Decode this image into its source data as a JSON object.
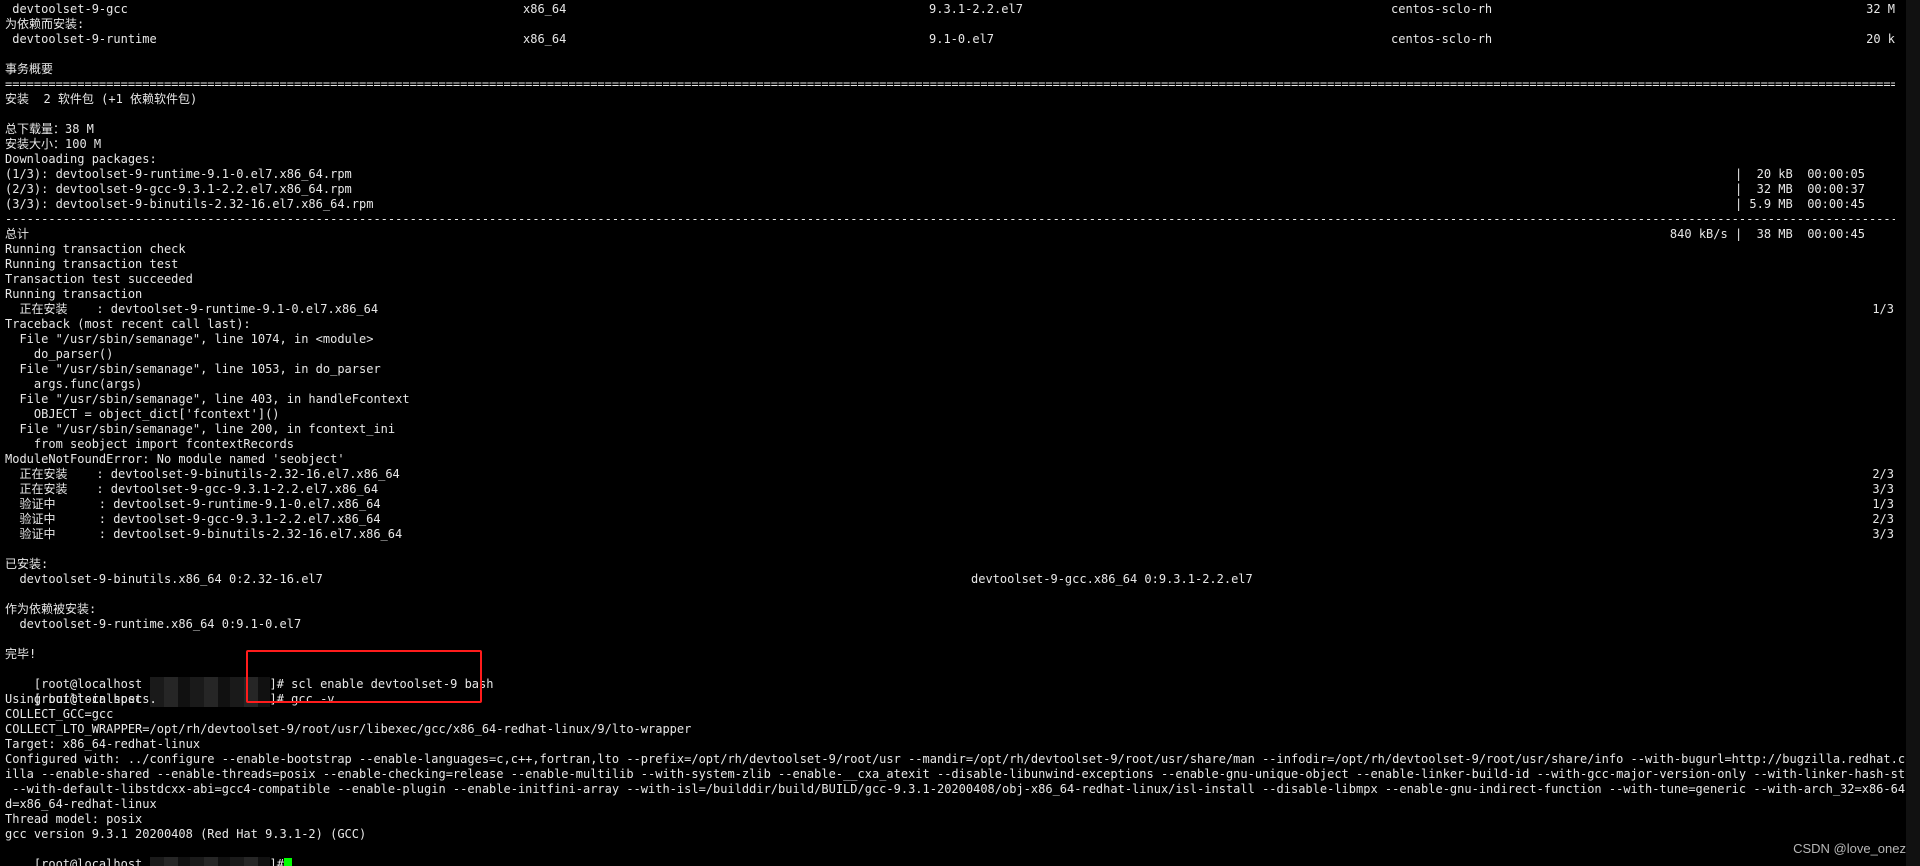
{
  "pkg_rows": [
    {
      "name": " devtoolset-9-gcc",
      "arch": "x86_64",
      "version": "9.3.1-2.2.el7",
      "repo": "centos-sclo-rh",
      "size": "32 M"
    },
    {
      "name": "为依赖而安装:",
      "arch": "",
      "version": "",
      "repo": "",
      "size": ""
    },
    {
      "name": " devtoolset-9-runtime",
      "arch": "x86_64",
      "version": "9.1-0.el7",
      "repo": "centos-sclo-rh",
      "size": "20 k"
    }
  ],
  "summary": {
    "title": "事务概要",
    "double_rule": "===========================================================================================================================================================================================================================================================================",
    "install_line": "安装  2 软件包 (+1 依赖软件包)",
    "total_download": "总下载量：38 M",
    "install_size": "安装大小：100 M",
    "downloading": "Downloading packages:"
  },
  "downloads": [
    {
      "file": "(1/3): devtoolset-9-runtime-9.1-0.el7.x86_64.rpm",
      "info": "|  20 kB  00:00:05"
    },
    {
      "file": "(2/3): devtoolset-9-gcc-9.3.1-2.2.el7.x86_64.rpm",
      "info": "|  32 MB  00:00:37"
    },
    {
      "file": "(3/3): devtoolset-9-binutils-2.32-16.el7.x86_64.rpm",
      "info": "| 5.9 MB  00:00:45"
    }
  ],
  "dash_rule": "---------------------------------------------------------------------------------------------------------------------------------------------------------------------------------------------------------------------------------------------------------------------------",
  "total": {
    "label": "总计",
    "info": "840 kB/s |  38 MB  00:00:45"
  },
  "transaction_lines": [
    "Running transaction check",
    "Running transaction test",
    "Transaction test succeeded",
    "Running transaction"
  ],
  "first_install": {
    "text": "  正在安装    : devtoolset-9-runtime-9.1-0.el7.x86_64",
    "count": "1/3"
  },
  "traceback_lines": [
    "Traceback (most recent call last):",
    "  File \"/usr/sbin/semanage\", line 1074, in <module>",
    "    do_parser()",
    "  File \"/usr/sbin/semanage\", line 1053, in do_parser",
    "    args.func(args)",
    "  File \"/usr/sbin/semanage\", line 403, in handleFcontext",
    "    OBJECT = object_dict['fcontext']()",
    "  File \"/usr/sbin/semanage\", line 200, in fcontext_ini",
    "    from seobject import fcontextRecords",
    "ModuleNotFoundError: No module named 'seobject'"
  ],
  "progress_lines": [
    {
      "text": "  正在安装    : devtoolset-9-binutils-2.32-16.el7.x86_64",
      "count": "2/3"
    },
    {
      "text": "  正在安装    : devtoolset-9-gcc-9.3.1-2.2.el7.x86_64",
      "count": "3/3"
    },
    {
      "text": "  验证中      : devtoolset-9-runtime-9.1-0.el7.x86_64",
      "count": "1/3"
    },
    {
      "text": "  验证中      : devtoolset-9-gcc-9.3.1-2.2.el7.x86_64",
      "count": "2/3"
    },
    {
      "text": "  验证中      : devtoolset-9-binutils-2.32-16.el7.x86_64",
      "count": "3/3"
    }
  ],
  "installed": {
    "title": "已安装:",
    "item1": "  devtoolset-9-binutils.x86_64 0:2.32-16.el7",
    "item2": "devtoolset-9-gcc.x86_64 0:9.3.1-2.2.el7"
  },
  "dep_installed": {
    "title": "作为依赖被安装:",
    "item": "  devtoolset-9-runtime.x86_64 0:9.1-0.el7"
  },
  "done": "完毕!",
  "prompt_user": "[root@localhost ",
  "prompt_end": "]#",
  "commands": [
    " scl enable devtoolset-9 bash",
    " gcc -v"
  ],
  "gcc_output": [
    "Using built-in specs.",
    "COLLECT_GCC=gcc",
    "COLLECT_LTO_WRAPPER=/opt/rh/devtoolset-9/root/usr/libexec/gcc/x86_64-redhat-linux/9/lto-wrapper",
    "Target: x86_64-redhat-linux",
    "Configured with: ../configure --enable-bootstrap --enable-languages=c,c++,fortran,lto --prefix=/opt/rh/devtoolset-9/root/usr --mandir=/opt/rh/devtoolset-9/root/usr/share/man --infodir=/opt/rh/devtoolset-9/root/usr/share/info --with-bugurl=http://bugzilla.redhat.com/bugz",
    "illa --enable-shared --enable-threads=posix --enable-checking=release --enable-multilib --with-system-zlib --enable-__cxa_atexit --disable-libunwind-exceptions --enable-gnu-unique-object --enable-linker-build-id --with-gcc-major-version-only --with-linker-hash-style=gnu",
    " --with-default-libstdcxx-abi=gcc4-compatible --enable-plugin --enable-initfini-array --with-isl=/builddir/build/BUILD/gcc-9.3.1-20200408/obj-x86_64-redhat-linux/isl-install --disable-libmpx --enable-gnu-indirect-function --with-tune=generic --with-arch_32=x86-64 --buil",
    "d=x86_64-redhat-linux",
    "Thread model: posix",
    "gcc version 9.3.1 20200408 (Red Hat 9.3.1-2) (GCC)"
  ],
  "watermark": "CSDN @love_onez",
  "colors": {
    "background": "#000000",
    "text": "#e8e8e8",
    "cursor": "#00ff00",
    "highlight_box": "#ff1c1c"
  }
}
